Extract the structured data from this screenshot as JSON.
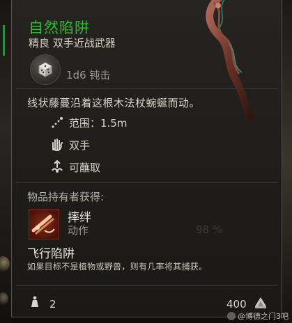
{
  "item": {
    "name": "自然陷阱",
    "rarity_type": "精良 双手近战武器",
    "damage": "1d6 钝击",
    "description": "线状藤蔓沿着这根木法杖蜿蜒而动。",
    "name_color": "#2cc02c"
  },
  "properties": [
    {
      "icon": "range-icon",
      "label": "范围：1.5m"
    },
    {
      "icon": "two-hands-icon",
      "label": "双手"
    },
    {
      "icon": "dippable-icon",
      "label": "可蘸取"
    }
  ],
  "granted": {
    "section_title": "物品持有者获得:",
    "ability": {
      "name": "摔绊",
      "type": "动作",
      "icon": "trip-attack-icon"
    },
    "passive": {
      "name": "飞行陷阱",
      "description": "如果目标不是植物或野兽，则有几率将其捕获。"
    }
  },
  "footer": {
    "weight": "2",
    "price": "400",
    "weight_icon": "weight-icon",
    "price_icon": "gold-coin-icon"
  },
  "background": {
    "obscured_text": "98 %"
  },
  "watermark": {
    "text": "@博德之门3吧"
  }
}
